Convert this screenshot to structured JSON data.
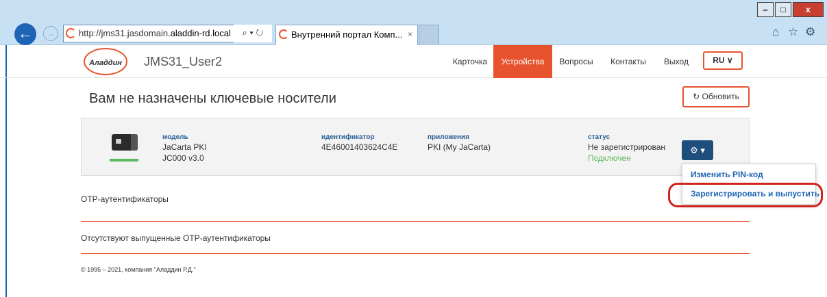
{
  "browser": {
    "url_prefix": "http://jms31.jasdomain.",
    "url_domain": "aladdin-rd.local",
    "addr_tools": "⌕ ▾ ↻",
    "tab_title": "Внутренний портал Комп...",
    "tab_close": "×",
    "win_min": "‒",
    "win_max": "□",
    "win_close": "x"
  },
  "header": {
    "logo_text": "Аладдин",
    "user": "JMS31_User2",
    "nav": [
      "Карточка",
      "Устройства",
      "Вопросы",
      "Контакты",
      "Выход"
    ],
    "active_nav": "Устройства",
    "lang": "RU ∨"
  },
  "main": {
    "title": "Вам не назначены ключевые носители",
    "refresh_label": "Обновить",
    "device": {
      "model_label": "модель",
      "model_line1": "JaCarta PKI",
      "model_line2": "JC000 v3.0",
      "id_label": "идентификатор",
      "id_value": "4E46001403624C4E",
      "apps_label": "приложения",
      "apps_value": "PKI (My JaCarta)",
      "status_label": "статус",
      "status_value": "Не зарегистрирован",
      "connection_value": "Подключен"
    },
    "dropdown": {
      "change_pin": "Изменить PIN-код",
      "register_issue": "Зарегистрировать и выпустить"
    },
    "otp_section": "OTP-аутентификаторы",
    "otp_empty": "Отсутствуют выпущенные OTP-аутентификаторы",
    "footer": "© 1995 – 2021, компания \"Аладдин Р.Д.\""
  },
  "colors": {
    "accent": "#e8532f",
    "link": "#1e64b4",
    "gear_button": "#1e4f7c",
    "connected": "#5cb85c",
    "highlight": "#d0231c"
  }
}
